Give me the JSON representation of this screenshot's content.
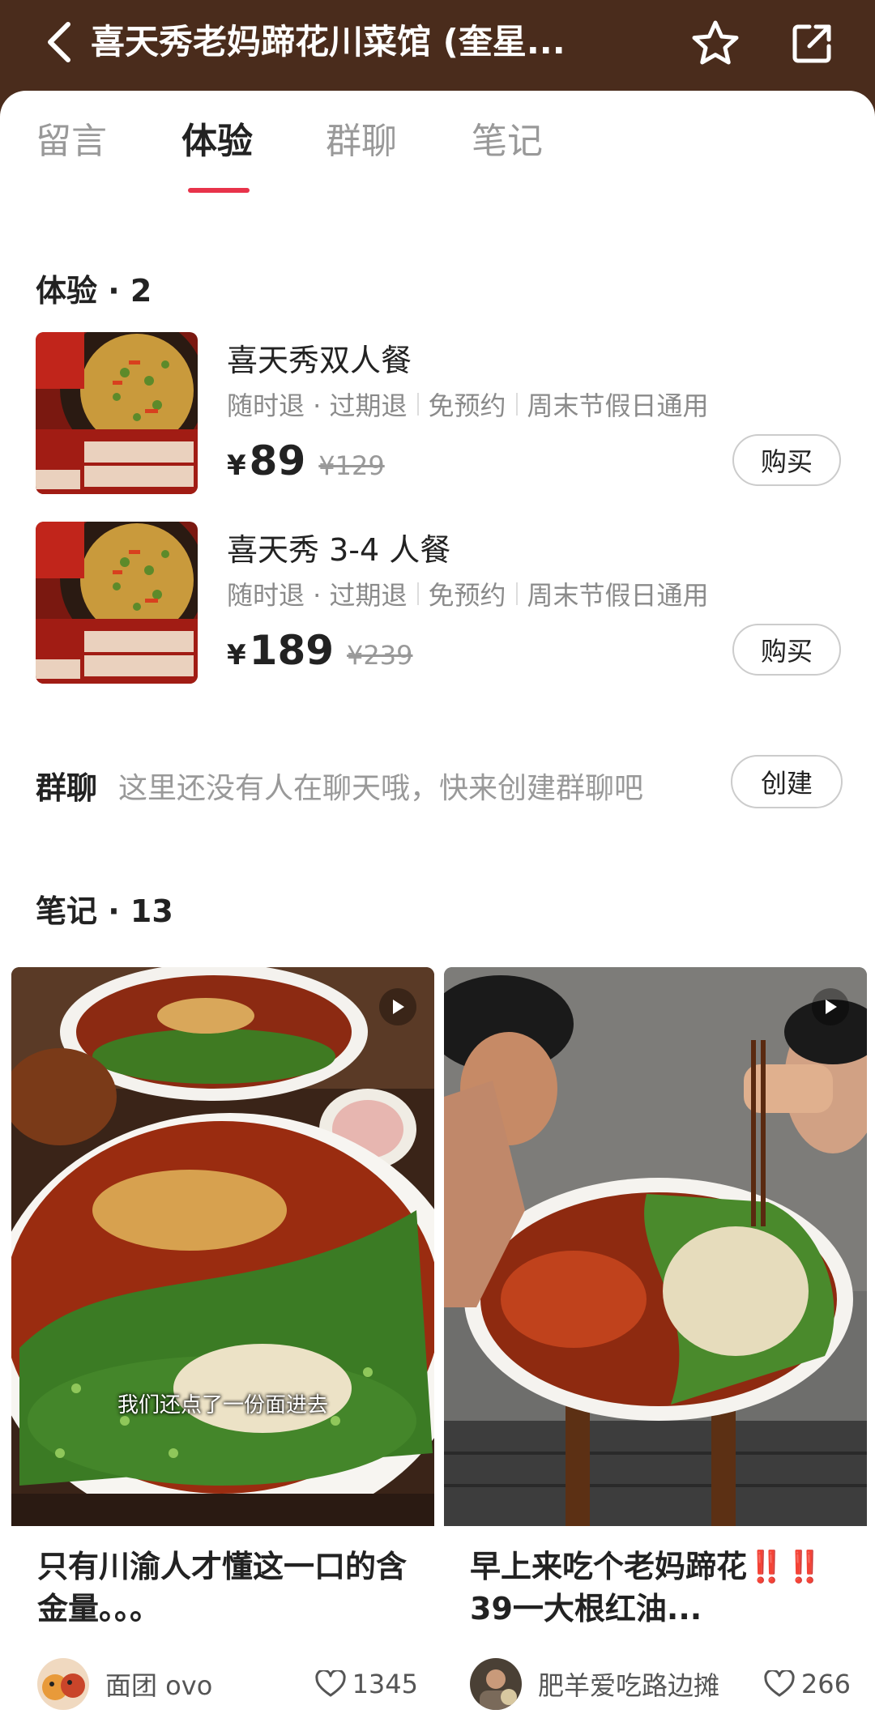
{
  "header": {
    "title": "喜天秀老妈蹄花川菜馆 (奎星...",
    "bg_color": "#4a2c1c"
  },
  "tabs": [
    {
      "label": "留言",
      "active": false
    },
    {
      "label": "体验",
      "active": true
    },
    {
      "label": "群聊",
      "active": false
    },
    {
      "label": "笔记",
      "active": false
    }
  ],
  "experience": {
    "title": "体验 · 2",
    "deals": [
      {
        "name": "喜天秀双人餐",
        "tags": [
          "随时退 · 过期退",
          "免预约",
          "周末节假日通用"
        ],
        "currency": "¥",
        "price": "89",
        "original_price": "¥129",
        "buy_label": "购买"
      },
      {
        "name": "喜天秀 3-4 人餐",
        "tags": [
          "随时退 · 过期退",
          "免预约",
          "周末节假日通用"
        ],
        "currency": "¥",
        "price": "189",
        "original_price": "¥239",
        "buy_label": "购买"
      }
    ]
  },
  "group_chat": {
    "label": "群聊",
    "hint": "这里还没有人在聊天哦，快来创建群聊吧",
    "create_label": "创建"
  },
  "notes": {
    "title": "笔记 · 13",
    "items": [
      {
        "caption": "我们还点了一份面进去",
        "title": "只有川渝人才懂这一口的含金量。。。",
        "author": "面团 ovo",
        "likes": "1345"
      },
      {
        "caption": "",
        "title": "早上来吃个老妈蹄花‼️‼️39一大根红油...",
        "author": "肥羊爱吃路边摊",
        "likes": "266"
      }
    ]
  },
  "colors": {
    "accent": "#e8334a",
    "muted": "#999999"
  }
}
